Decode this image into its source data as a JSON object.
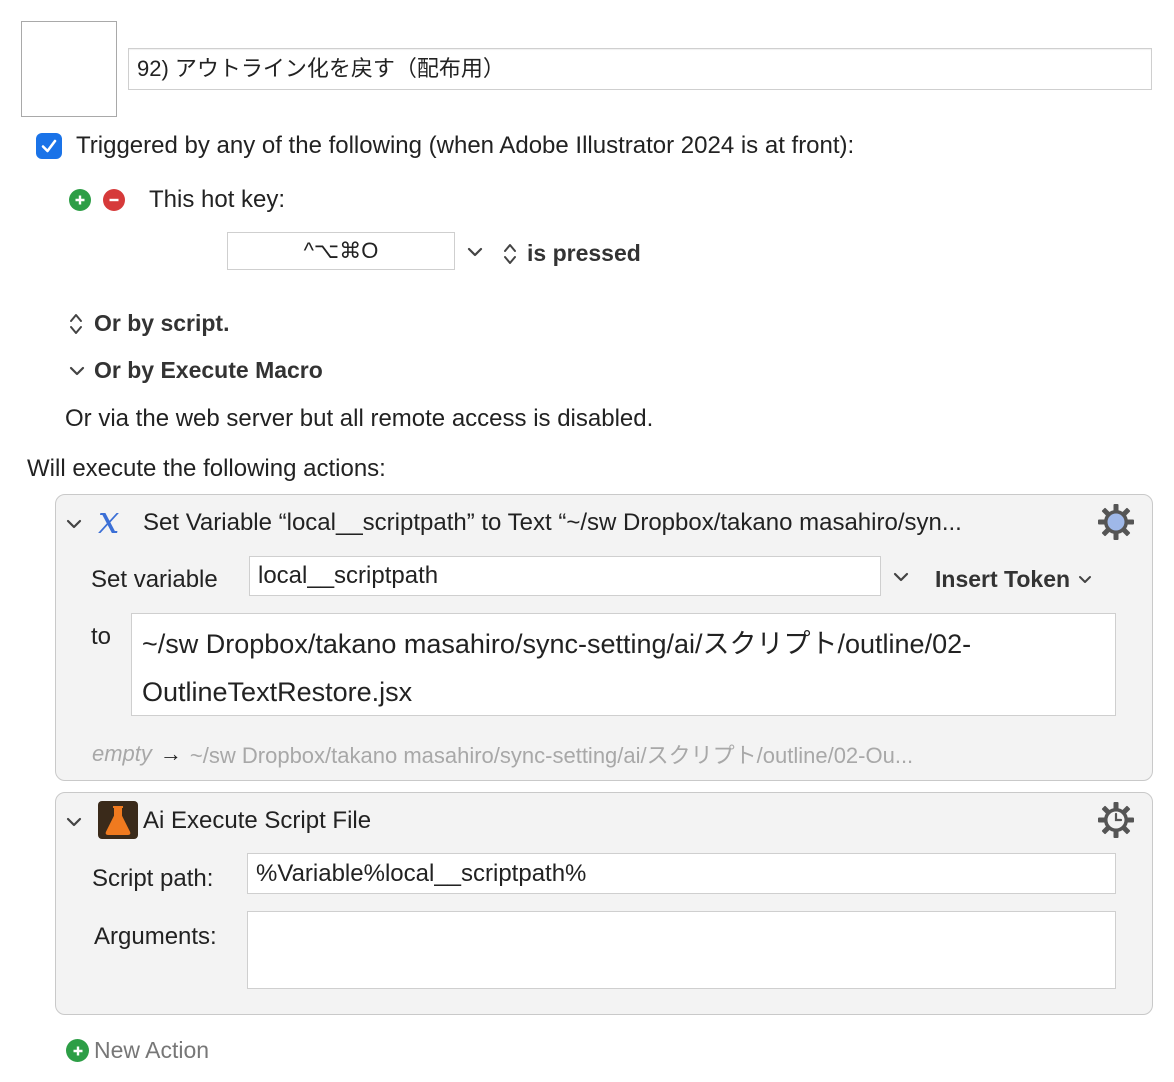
{
  "macro": {
    "name": "92) アウトライン化を戻す（配布用）"
  },
  "trigger": {
    "checkbox_label": "Triggered by any of the following (when Adobe Illustrator 2024 is at front):",
    "hotkey_label": "This hot key:",
    "hotkey_value": "^⌥⌘O",
    "pressed_label": "is pressed",
    "or_by_script": "Or by script.",
    "or_by_execute_macro": "Or by Execute Macro",
    "web_server_note": "Or via the web server but all remote access is disabled."
  },
  "actions_header": "Will execute the following actions:",
  "actions": [
    {
      "title": "Set Variable “local__scriptpath” to Text “~/sw Dropbox/takano masahiro/syn...",
      "set_variable_label": "Set variable",
      "variable_value": "local__scriptpath",
      "insert_token_label": "Insert Token",
      "to_label": "to",
      "to_value_line1": "~/sw Dropbox/takano masahiro/sync-setting/ai/スクリプト/outline/02-",
      "to_value_line2": "OutlineTextRestore.jsx",
      "preview_empty": "empty",
      "preview_arrow": "→",
      "preview_result": "~/sw Dropbox/takano masahiro/sync-setting/ai/スクリプト/outline/02-Ou..."
    },
    {
      "title": "Ai Execute Script File",
      "script_path_label": "Script path:",
      "script_path_value": "%Variable%local__scriptpath%",
      "arguments_label": "Arguments:",
      "arguments_value": ""
    }
  ],
  "new_action_label": "New Action",
  "colors": {
    "accent_blue": "#1a73e8",
    "add_green": "#2d9e46",
    "remove_red": "#d63a3a",
    "variable_icon_blue": "#3b6fd6",
    "illustrator_icon_bg": "#3a2a1a",
    "illustrator_icon_flask": "#f07a1f"
  },
  "icons": {
    "checkbox": "checkmark-icon",
    "add": "plus-circle-icon",
    "remove": "minus-circle-icon",
    "variable": "variable-x-icon",
    "illustrator": "flask-icon",
    "gear": "gear-icon",
    "disclosure": "chevron-down-icon",
    "stepper": "up-down-chevron-icon"
  }
}
